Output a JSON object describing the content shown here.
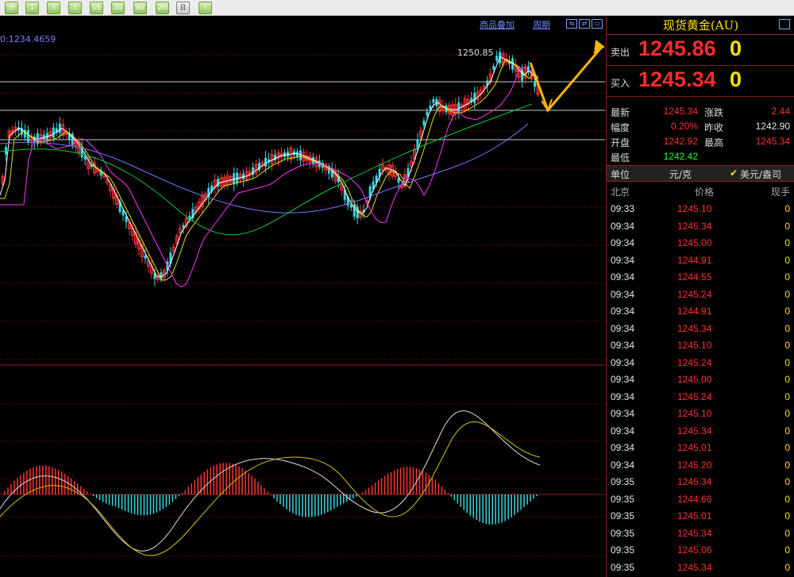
{
  "toolbar": {
    "buttons": [
      "分",
      "1",
      "5",
      "5",
      "15",
      "30",
      "60",
      "2H",
      "日",
      "Y"
    ],
    "selected_index": 8
  },
  "chart": {
    "avg_readout": "0:1234.4659",
    "overlay_link": "商品叠加",
    "period_link": "周期",
    "high_label": "1250.85",
    "colors": {
      "up": "#ff3333",
      "down": "#35d8e0",
      "ma5": "#ffffff",
      "ma10": "#e8e000",
      "ma20": "#ff33ff",
      "ma30": "#00cc44",
      "ma60": "#7777ff",
      "arrow": "#ffb400",
      "hline": "#c8c8c8"
    }
  },
  "panel": {
    "title": "现货黄金(AU)",
    "sell": {
      "label": "卖出",
      "price": "1245.86",
      "vol": "0"
    },
    "buy": {
      "label": "买入",
      "price": "1245.34",
      "vol": "0"
    },
    "stats": [
      {
        "l1": "最新",
        "v1": "1245.34",
        "l2": "涨跌",
        "v2": "2.44"
      },
      {
        "l1": "幅度",
        "v1": "0.20%",
        "l2": "昨收",
        "v2": "1242.90"
      },
      {
        "l1": "开盘",
        "v1": "1242.92",
        "l2": "最高",
        "v2": "1245.34"
      },
      {
        "l1": "最低",
        "v1": "1242.42",
        "l2": "",
        "v2": ""
      }
    ],
    "unit": {
      "label": "单位",
      "value": "元/克",
      "option": "美元/盎司",
      "check": "✔"
    },
    "tick_head": {
      "city": "北京",
      "price": "价格",
      "vol": "现手"
    },
    "ticks": [
      {
        "time": "09:33",
        "price": "1245.10",
        "vol": "0"
      },
      {
        "time": "09:34",
        "price": "1245.34",
        "vol": "0"
      },
      {
        "time": "09:34",
        "price": "1245.00",
        "vol": "0"
      },
      {
        "time": "09:34",
        "price": "1244.91",
        "vol": "0"
      },
      {
        "time": "09:34",
        "price": "1244.55",
        "vol": "0"
      },
      {
        "time": "09:34",
        "price": "1245.24",
        "vol": "0"
      },
      {
        "time": "09:34",
        "price": "1244.91",
        "vol": "0"
      },
      {
        "time": "09:34",
        "price": "1245.34",
        "vol": "0"
      },
      {
        "time": "09:34",
        "price": "1245.10",
        "vol": "0"
      },
      {
        "time": "09:34",
        "price": "1245.24",
        "vol": "0"
      },
      {
        "time": "09:34",
        "price": "1245.00",
        "vol": "0"
      },
      {
        "time": "09:34",
        "price": "1245.24",
        "vol": "0"
      },
      {
        "time": "09:34",
        "price": "1245.10",
        "vol": "0"
      },
      {
        "time": "09:34",
        "price": "1245.34",
        "vol": "0"
      },
      {
        "time": "09:34",
        "price": "1245.01",
        "vol": "0"
      },
      {
        "time": "09:34",
        "price": "1245.20",
        "vol": "0"
      },
      {
        "time": "09:35",
        "price": "1245.34",
        "vol": "0"
      },
      {
        "time": "09:35",
        "price": "1244.66",
        "vol": "0"
      },
      {
        "time": "09:35",
        "price": "1245.01",
        "vol": "0"
      },
      {
        "time": "09:35",
        "price": "1245.34",
        "vol": "0"
      },
      {
        "time": "09:35",
        "price": "1245.06",
        "vol": "0"
      },
      {
        "time": "09:35",
        "price": "1245.34",
        "vol": "0"
      }
    ]
  }
}
